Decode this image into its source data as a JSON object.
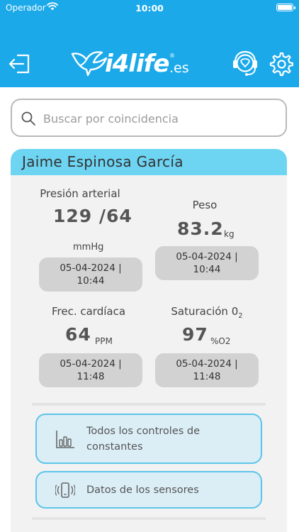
{
  "status_bar": {
    "carrier": "Operador",
    "time": "10:00"
  },
  "header": {
    "brand": "i4life",
    "brand_reg": "®",
    "brand_tld": ".es",
    "icons": {
      "logout": "logout-icon",
      "support": "support-headset-icon",
      "settings": "gear-icon"
    },
    "colors": {
      "header_bg": "#1ba9ea",
      "card_header_bg": "#6dd4f2",
      "accent": "#5cc4ea"
    }
  },
  "search": {
    "placeholder": "Buscar por coincidencia",
    "value": ""
  },
  "patient": {
    "name": "Jaime Espinosa García"
  },
  "metrics": {
    "blood_pressure": {
      "label": "Presión arterial",
      "value": "129 /64",
      "unit": "mmHg",
      "date": "05-04-2024 |",
      "time": "10:44"
    },
    "weight": {
      "label": "Peso",
      "value": "83.2",
      "unit": "kg",
      "date": "05-04-2024 |",
      "time": "10:44"
    },
    "heart_rate": {
      "label": "Frec. cardíaca",
      "value": "64",
      "unit": "PPM",
      "date": "05-04-2024 |",
      "time": "11:48"
    },
    "saturation": {
      "label": "Saturación 0",
      "label_sub": "2",
      "value": "97",
      "unit": "%O2",
      "date": "05-04-2024 |",
      "time": "11:48"
    }
  },
  "actions": {
    "controls": {
      "line1": "Todos los controles de",
      "line2": "constantes",
      "icon": "bar-chart-icon"
    },
    "sensors": {
      "label": "Datos de los sensores",
      "icon": "vibrating-phone-icon"
    }
  }
}
